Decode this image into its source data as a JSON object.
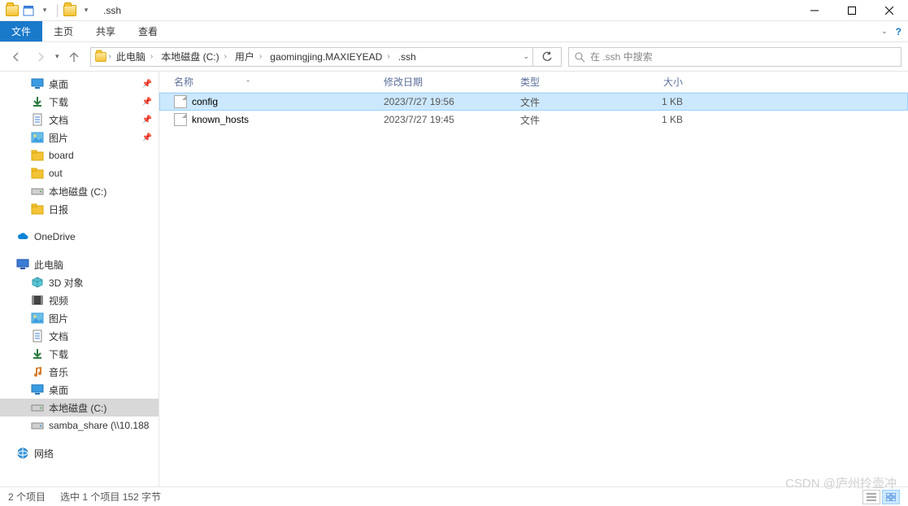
{
  "window": {
    "title": ".ssh"
  },
  "ribbon": {
    "file": "文件",
    "tabs": [
      "主页",
      "共享",
      "查看"
    ]
  },
  "breadcrumbs": [
    "此电脑",
    "本地磁盘 (C:)",
    "用户",
    "gaomingjing.MAXIEYEAD",
    ".ssh"
  ],
  "search": {
    "placeholder": "在 .ssh 中搜索"
  },
  "columns": {
    "name": "名称",
    "date": "修改日期",
    "type": "类型",
    "size": "大小"
  },
  "files": [
    {
      "name": "config",
      "date": "2023/7/27 19:56",
      "type": "文件",
      "size": "1 KB",
      "selected": true
    },
    {
      "name": "known_hosts",
      "date": "2023/7/27 19:45",
      "type": "文件",
      "size": "1 KB",
      "selected": false
    }
  ],
  "sidebar": {
    "quick": [
      {
        "label": "桌面",
        "icon": "desktop",
        "pin": true
      },
      {
        "label": "下载",
        "icon": "download",
        "pin": true
      },
      {
        "label": "文档",
        "icon": "doc",
        "pin": true
      },
      {
        "label": "图片",
        "icon": "image",
        "pin": true
      },
      {
        "label": "board",
        "icon": "folder",
        "pin": false
      },
      {
        "label": "out",
        "icon": "folder",
        "pin": false
      },
      {
        "label": "本地磁盘 (C:)",
        "icon": "drive",
        "pin": false
      },
      {
        "label": "日报",
        "icon": "folder",
        "pin": false
      }
    ],
    "onedrive": "OneDrive",
    "thispc_label": "此电脑",
    "thispc": [
      {
        "label": "3D 对象",
        "icon": "3d"
      },
      {
        "label": "视频",
        "icon": "video"
      },
      {
        "label": "图片",
        "icon": "image"
      },
      {
        "label": "文档",
        "icon": "doc"
      },
      {
        "label": "下载",
        "icon": "download"
      },
      {
        "label": "音乐",
        "icon": "music"
      },
      {
        "label": "桌面",
        "icon": "desktop"
      },
      {
        "label": "本地磁盘 (C:)",
        "icon": "drive"
      },
      {
        "label": "samba_share (\\\\10.188",
        "icon": "netdrive"
      }
    ],
    "network": "网络"
  },
  "status": {
    "count": "2 个项目",
    "selection": "选中 1 个项目 152 字节"
  },
  "watermark": "CSDN @庐州拎壶冲"
}
